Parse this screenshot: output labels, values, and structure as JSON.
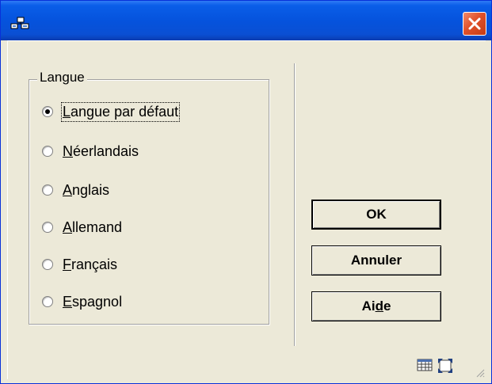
{
  "window": {
    "title": ""
  },
  "language_group": {
    "label": "Langue",
    "options": [
      {
        "pre": "",
        "acc": "L",
        "post": "angue par défaut",
        "selected": true
      },
      {
        "pre": "",
        "acc": "N",
        "post": "éerlandais",
        "selected": false
      },
      {
        "pre": "",
        "acc": "A",
        "post": "nglais",
        "selected": false
      },
      {
        "pre": "",
        "acc": "A",
        "post": "llemand",
        "selected": false
      },
      {
        "pre": "",
        "acc": "F",
        "post": "rançais",
        "selected": false
      },
      {
        "pre": "",
        "acc": "E",
        "post": "spagnol",
        "selected": false
      }
    ]
  },
  "buttons": {
    "ok": {
      "label": "OK"
    },
    "cancel": {
      "label": "Annuler"
    },
    "help": {
      "pre": "Ai",
      "acc": "d",
      "post": "e"
    }
  },
  "icons": {
    "app": "app-network-icon",
    "close": "close-icon",
    "status_1": "grid-icon",
    "status_2": "expand-icon",
    "grip": "resize-grip-icon"
  },
  "colors": {
    "titlebar": "#0553dd",
    "close_button": "#e0512a",
    "dialog_bg": "#ece9d8"
  }
}
